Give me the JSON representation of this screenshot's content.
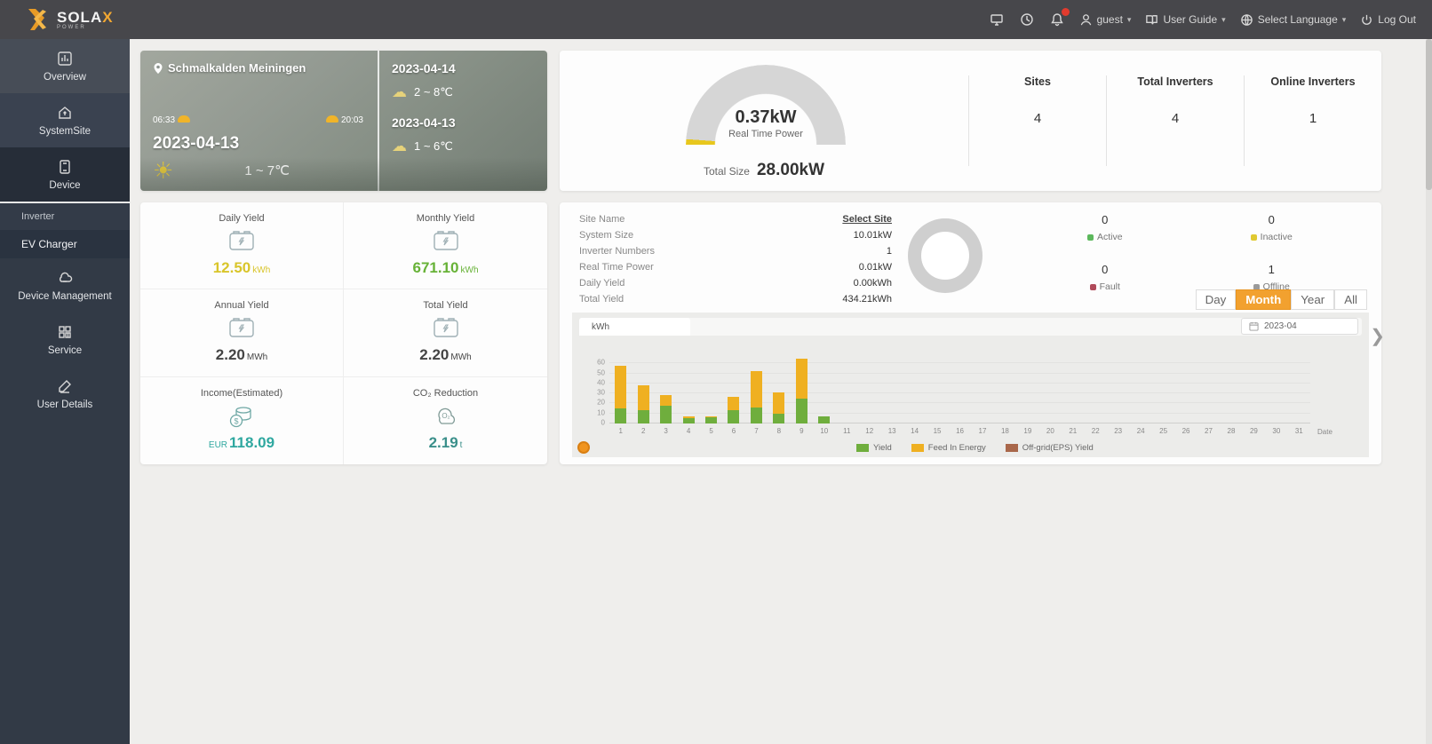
{
  "topbar": {
    "brand": "SOLA",
    "brand_x": "X",
    "brand_sub": "POWER",
    "user": "guest",
    "user_guide": "User Guide",
    "select_language": "Select Language",
    "log_out": "Log Out"
  },
  "sidebar": {
    "items": [
      {
        "label": "Overview",
        "icon": "overview-icon"
      },
      {
        "label": "SystemSite",
        "icon": "home-icon"
      },
      {
        "label": "Device",
        "icon": "device-icon"
      }
    ],
    "submenu": [
      {
        "label": "Inverter",
        "active": false
      },
      {
        "label": "EV Charger",
        "active": true
      }
    ],
    "items2": [
      {
        "label": "Device Management",
        "icon": "device-management-icon"
      },
      {
        "label": "Service",
        "icon": "service-icon"
      },
      {
        "label": "User Details",
        "icon": "user-details-icon"
      }
    ]
  },
  "weather": {
    "location": "Schmalkalden Meiningen",
    "sunrise": "06:33",
    "sunset": "20:03",
    "today_date": "2023-04-13",
    "today_temp": "1 ~ 7℃",
    "forecast": [
      {
        "date": "2023-04-14",
        "temp": "2 ~ 8℃"
      },
      {
        "date": "2023-04-13",
        "temp": "1 ~ 6℃"
      }
    ]
  },
  "summary": {
    "real_time_power": "0.37kW",
    "real_time_power_label": "Real Time Power",
    "total_size_label": "Total Size",
    "total_size": "28.00kW",
    "columns": [
      {
        "label": "Sites",
        "value": "4"
      },
      {
        "label": "Total Inverters",
        "value": "4"
      },
      {
        "label": "Online Inverters",
        "value": "1"
      }
    ]
  },
  "stats": {
    "tiles": [
      {
        "label": "Daily Yield",
        "icon": "yield-icon",
        "value": "12.50",
        "unit": "kWh",
        "prefix": "",
        "color": "#d9c52a"
      },
      {
        "label": "Monthly Yield",
        "icon": "yield-icon",
        "value": "671.10",
        "unit": "kWh",
        "prefix": "",
        "color": "#67b237"
      },
      {
        "label": "Annual Yield",
        "icon": "yield-icon",
        "value": "2.20",
        "unit": "MWh",
        "prefix": "",
        "color": "#444444"
      },
      {
        "label": "Total Yield",
        "icon": "yield-icon",
        "value": "2.20",
        "unit": "MWh",
        "prefix": "",
        "color": "#444444"
      },
      {
        "label": "Income(Estimated)",
        "icon": "income-icon",
        "value": "118.09",
        "unit": "",
        "prefix": "EUR",
        "color": "#2fa8a0"
      },
      {
        "label": "CO₂ Reduction",
        "icon": "co2-icon",
        "value": "2.19",
        "unit": "t",
        "prefix": "",
        "color": "#3a8f8a"
      }
    ]
  },
  "site": {
    "info": [
      {
        "label": "Site Name",
        "value": "Select Site",
        "link": true
      },
      {
        "label": "System Size",
        "value": "10.01kW"
      },
      {
        "label": "Inverter Numbers",
        "value": "1"
      },
      {
        "label": "Real Time Power",
        "value": "0.01kW"
      },
      {
        "label": "Daily Yield",
        "value": "0.00kWh"
      },
      {
        "label": "Total Yield",
        "value": "434.21kWh"
      }
    ],
    "statuses": [
      {
        "value": "0",
        "label": "Active",
        "color": "#5cb85c"
      },
      {
        "value": "0",
        "label": "Inactive",
        "color": "#e0c931"
      },
      {
        "value": "0",
        "label": "Fault",
        "color": "#b04a5a"
      },
      {
        "value": "1",
        "label": "Offline",
        "color": "#9a9a9a"
      }
    ],
    "range_options": [
      "Day",
      "Month",
      "Year",
      "All"
    ],
    "range_active": "Month",
    "date_picker": "2023-04"
  },
  "chart_data": {
    "type": "bar",
    "stacked": true,
    "unit_tab": "kWh",
    "categories": [
      1,
      2,
      3,
      4,
      5,
      6,
      7,
      8,
      9,
      10,
      11,
      12,
      13,
      14,
      15,
      16,
      17,
      18,
      19,
      20,
      21,
      22,
      23,
      24,
      25,
      26,
      27,
      28,
      29,
      30,
      31
    ],
    "series": [
      {
        "name": "Yield",
        "color": "#6fae3d",
        "values": [
          15,
          13,
          18,
          5,
          6,
          13,
          16,
          10,
          25,
          7,
          0,
          0,
          0,
          0,
          0,
          0,
          0,
          0,
          0,
          0,
          0,
          0,
          0,
          0,
          0,
          0,
          0,
          0,
          0,
          0,
          0
        ]
      },
      {
        "name": "Feed In Energy",
        "color": "#efb021",
        "values": [
          43,
          25,
          10,
          2,
          1,
          14,
          36,
          21,
          40,
          0,
          0,
          0,
          0,
          0,
          0,
          0,
          0,
          0,
          0,
          0,
          0,
          0,
          0,
          0,
          0,
          0,
          0,
          0,
          0,
          0,
          0
        ]
      },
      {
        "name": "Off-grid(EPS) Yield",
        "color": "#a9674a",
        "values": [
          0,
          0,
          0,
          0,
          0,
          0,
          0,
          0,
          0,
          0,
          0,
          0,
          0,
          0,
          0,
          0,
          0,
          0,
          0,
          0,
          0,
          0,
          0,
          0,
          0,
          0,
          0,
          0,
          0,
          0,
          0
        ]
      }
    ],
    "ylim": [
      0,
      70
    ],
    "yticks": [
      0,
      10,
      20,
      30,
      40,
      50,
      60
    ],
    "xlabel_end": "Date",
    "legend_position": "bottom",
    "grid": true
  }
}
